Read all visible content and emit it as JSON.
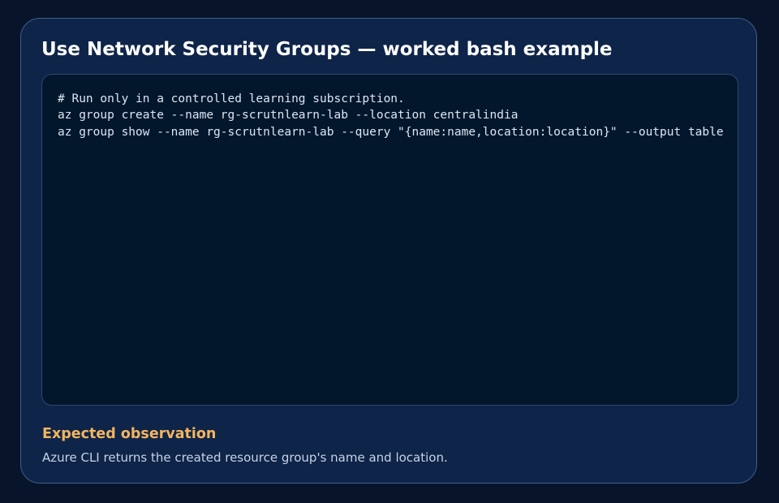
{
  "card": {
    "title": "Use Network Security Groups — worked bash example"
  },
  "code_block": {
    "language": "bash",
    "lines": [
      "# Run only in a controlled learning subscription.",
      "az group create --name rg-scrutnlearn-lab --location centralindia",
      "az group show --name rg-scrutnlearn-lab --query \"{name:name,location:location}\" --output table"
    ]
  },
  "observation": {
    "heading": "Expected observation",
    "text": "Azure CLI returns the created resource group's name and location."
  },
  "colors": {
    "page_background": "#08142a",
    "card_background": "#0e2449",
    "card_border": "#3f5f8f",
    "code_background": "#03172c",
    "code_text": "#dde6f2",
    "heading_accent": "#f3b55e",
    "body_text": "#c7d3e6"
  }
}
